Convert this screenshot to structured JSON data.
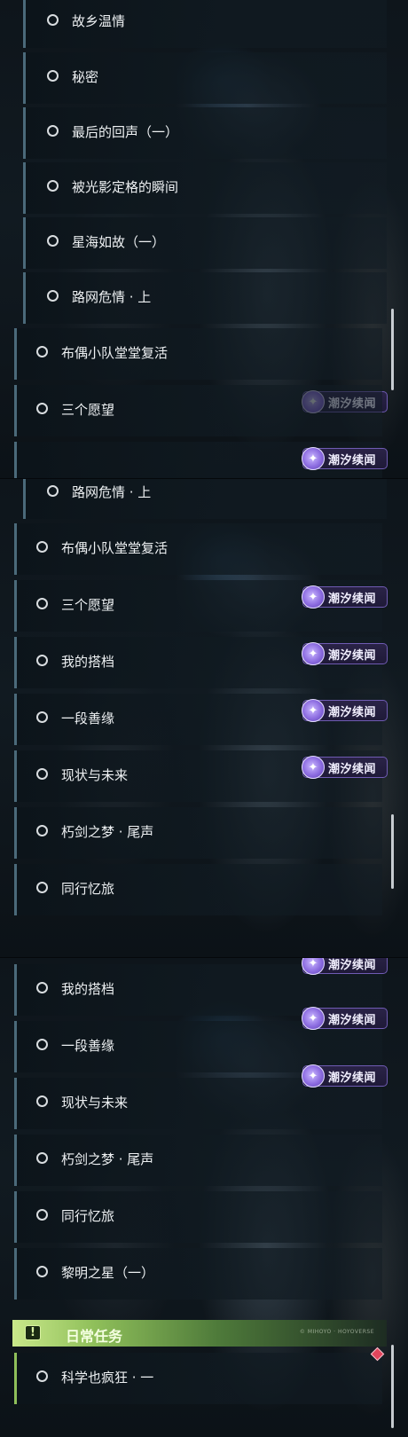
{
  "panel1": {
    "rows": [
      "故乡温情",
      "秘密",
      "最后的回声（一）",
      "被光影定格的瞬间",
      "星海如故（一）",
      "路网危情 · 上",
      "布偶小队堂堂复活",
      "三个愿望"
    ]
  },
  "panel2": {
    "rows": [
      "路网危情 · 上",
      "布偶小队堂堂复活",
      "三个愿望",
      "我的搭档",
      "一段善缘",
      "现状与未来",
      "朽剑之梦 · 尾声",
      "同行忆旅"
    ]
  },
  "panel3": {
    "rows": [
      "我的搭档",
      "一段善缘",
      "现状与未来",
      "朽剑之梦 · 尾声",
      "同行忆旅",
      "黎明之星（一）"
    ],
    "daily": {
      "title": "日常任务",
      "small_text": "© MIHOYO · HOYOVERSE",
      "rows": [
        "科学也疯狂 · 一"
      ]
    }
  },
  "badge": {
    "label": "潮汐续闻",
    "icon": "tide-sequel-icon"
  },
  "colors": {
    "badge_border": "#6f5bb3",
    "daily_accent": "#8fbf5a",
    "alert": "#e2455c"
  }
}
